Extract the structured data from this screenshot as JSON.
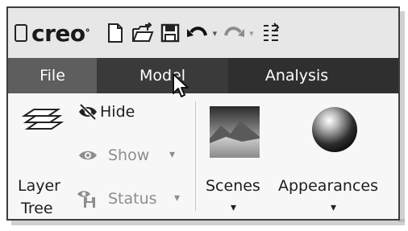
{
  "app": {
    "logo_text": "creo",
    "logo_mark": "°"
  },
  "quick_access": {
    "icons": [
      "new-file-icon",
      "open-folder-icon",
      "save-icon",
      "undo-icon",
      "redo-icon",
      "regenerate-icon"
    ],
    "undo_arrow": "▾",
    "redo_arrow": "▾"
  },
  "tabs": [
    {
      "label": "File"
    },
    {
      "label": "Model"
    },
    {
      "label": "Analysis"
    }
  ],
  "ribbon": {
    "layer_tree": {
      "line1": "Layer",
      "line2": "Tree"
    },
    "hide": {
      "label": "Hide"
    },
    "show": {
      "label": "Show",
      "arrow": "▾"
    },
    "status": {
      "label": "Status",
      "arrow": "▾"
    },
    "scenes": {
      "label": "Scenes",
      "arrow": "▾"
    },
    "appearances": {
      "label": "Appearances",
      "arrow": "▾"
    }
  },
  "colors": {
    "tab_bar": "#2f2f2f",
    "tab_file": "#5e5e5e",
    "tab_model": "#3a3a3a",
    "ribbon_bg": "#f7f7f7",
    "disabled_text": "#8d8d8d"
  }
}
